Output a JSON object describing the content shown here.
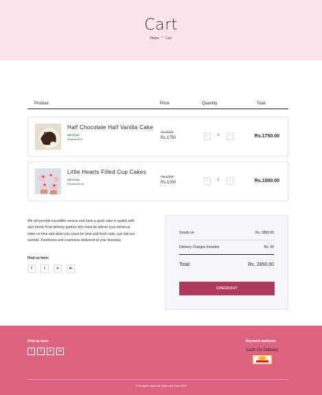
{
  "hero": {
    "title": "Cart",
    "breadcrumb": {
      "home": "Home",
      "separator": "^",
      "current": "Cart"
    }
  },
  "table": {
    "headers": {
      "product": "Product",
      "price": "Price",
      "quantity": "Quantity",
      "total": "Total"
    }
  },
  "items": [
    {
      "name": "Half Chocolate Half Vanilla Cake",
      "type": "WEYDOK",
      "product_id": "Product ID:4",
      "old_price": "Rs.2000",
      "price": "Rs.1750",
      "quantity": "1",
      "total": "Rs.1750.00",
      "minus": "‹",
      "plus": "›"
    },
    {
      "name": "Little Hearts Filled Cup Cakes",
      "type": "WEYDOK",
      "product_id": "Product ID:12",
      "old_price": "Rs.1200",
      "price": "Rs.1000",
      "quantity": "1",
      "total": "Rs.1000.00",
      "minus": "‹",
      "plus": "›"
    }
  ],
  "about": {
    "text": "We will provide incredible service and have a good cake in quality with also trendy food delivery partner who must be deliver your delicious order on time and when you crave for best and fresh cake, just dial our number. Freshness and crashness delivered at your doorstep.",
    "find_us": "Find us here:",
    "socials": [
      "f",
      "t",
      "o",
      "in"
    ]
  },
  "summary": {
    "goods_label": "Goods on",
    "goods_value": "Rs. 2850.00",
    "delivery_label": "Delivery Charges Includes",
    "delivery_value": "Rs. 50",
    "total_label": "Total:",
    "total_value": "Rs. 2850.00",
    "checkout": "CHECKOUT"
  },
  "footer": {
    "find_us": "Find us here:",
    "socials": [
      "f",
      "t",
      "o",
      "in"
    ],
    "payment_label": "Payment methods:",
    "cod": "Cash On Delivery",
    "copyright": "© All rights reserved. Bake and Take 2022"
  },
  "colors": {
    "accent": "#b03a5e",
    "hero_bg": "#fce4ea",
    "footer_bg": "#de6381",
    "summary_bg": "#f7f5fc"
  }
}
